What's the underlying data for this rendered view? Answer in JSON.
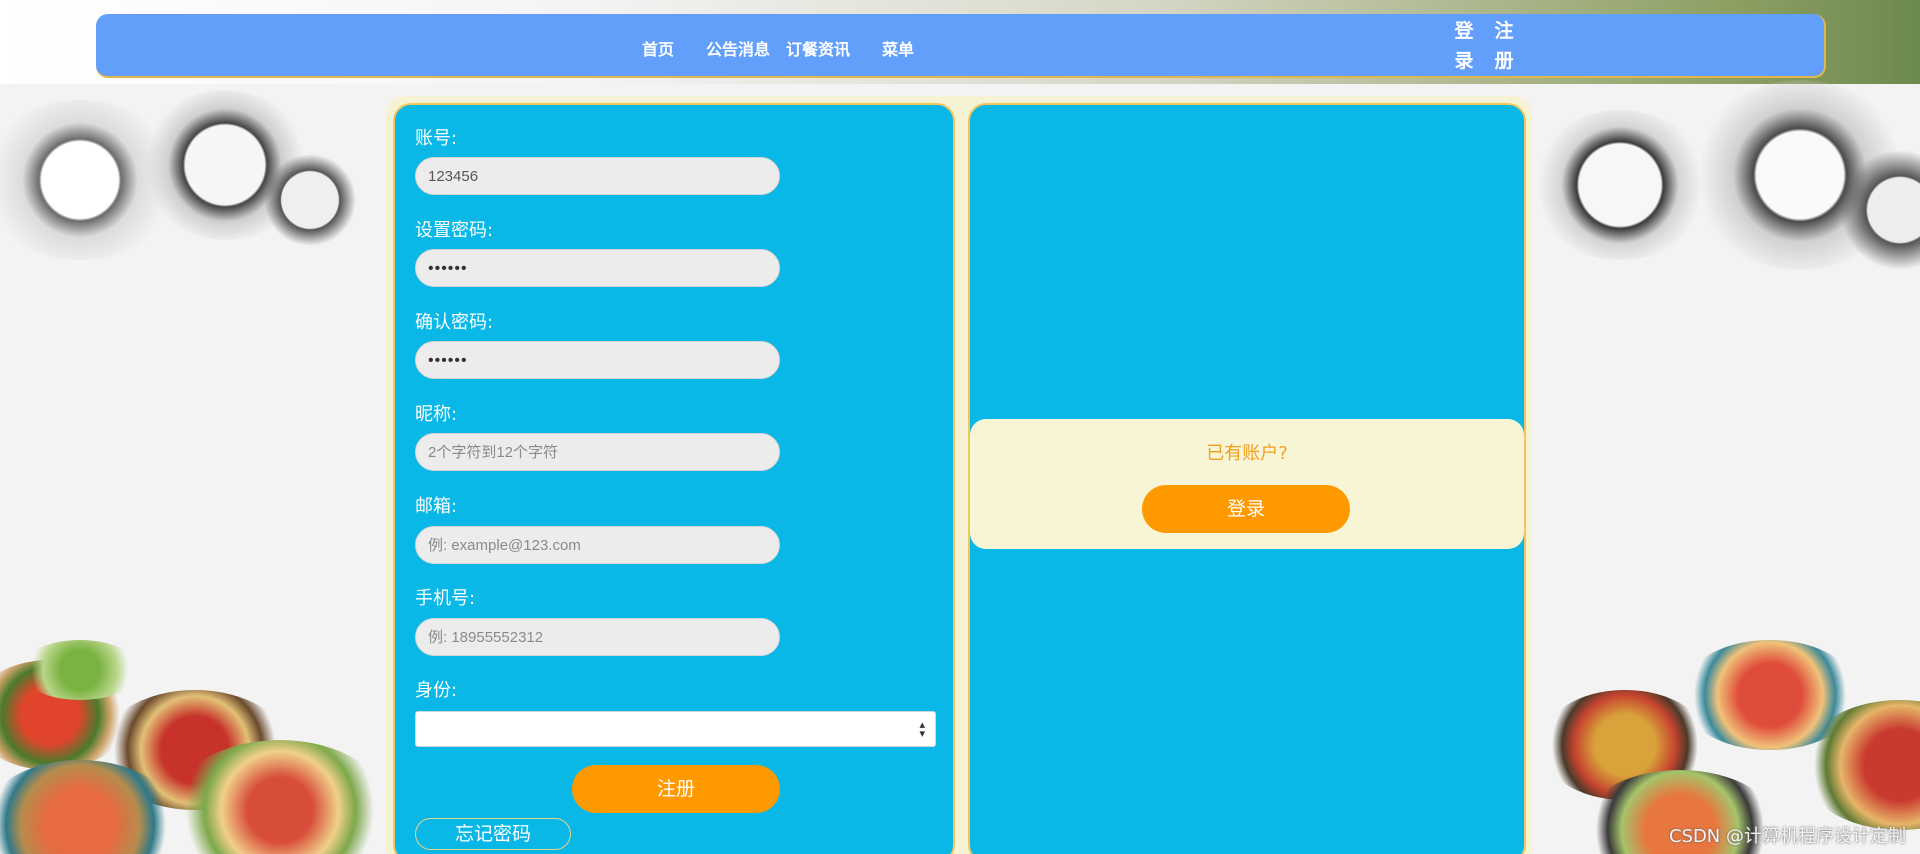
{
  "nav": {
    "home": "首页",
    "announcements": "公告消息",
    "dining_info": "订餐资讯",
    "menu": "菜单",
    "login_top": "登",
    "login_bottom": "录",
    "register_top": "注",
    "register_bottom": "册"
  },
  "form": {
    "account_label": "账号:",
    "account_value": "123456",
    "password_label": "设置密码:",
    "password_value": "••••••",
    "confirm_label": "确认密码:",
    "confirm_value": "••••••",
    "nickname_label": "昵称:",
    "nickname_placeholder": "2个字符到12个字符",
    "email_label": "邮箱:",
    "email_placeholder": "例: example@123.com",
    "phone_label": "手机号:",
    "phone_placeholder": "例: 18955552312",
    "identity_label": "身份:",
    "identity_value": "",
    "register_button": "注册",
    "forgot_button": "忘记密码"
  },
  "login_panel": {
    "question": "已有账户?",
    "login_button": "登录"
  },
  "watermark": "CSDN @计算机程序设计定制"
}
